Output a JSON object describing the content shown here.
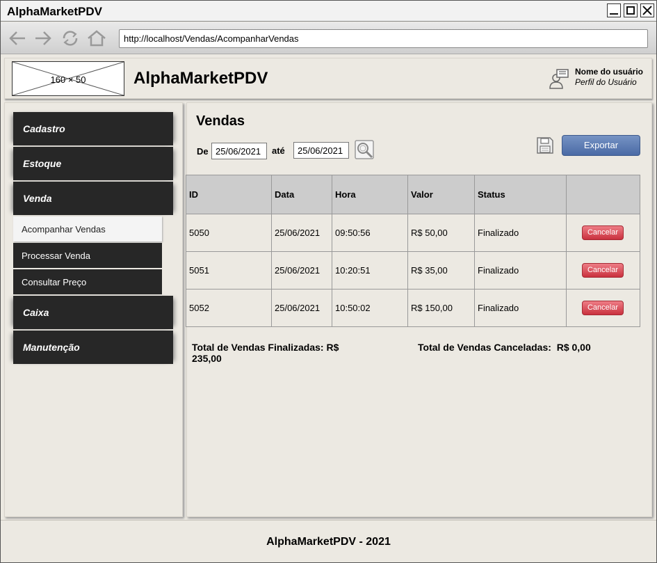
{
  "window": {
    "title": "AlphaMarketPDV"
  },
  "browser": {
    "url": "http://localhost/Vendas/AcompanharVendas"
  },
  "header": {
    "logo_placeholder": "160 × 50",
    "app_title": "AlphaMarketPDV",
    "user_name": "Nome do usuário",
    "user_role": "Perfil do Usuário"
  },
  "sidebar": {
    "items": [
      {
        "label": "Cadastro"
      },
      {
        "label": "Estoque"
      },
      {
        "label": "Venda"
      },
      {
        "label": "Acompanhar Vendas",
        "active": true
      },
      {
        "label": "Processar Venda"
      },
      {
        "label": "Consultar Preço"
      },
      {
        "label": "Caixa"
      },
      {
        "label": "Manutenção"
      }
    ]
  },
  "main": {
    "title": "Vendas",
    "filter": {
      "from_label": "De",
      "from_value": "25/06/2021",
      "to_label": "até",
      "to_value": "25/06/2021"
    },
    "export_label": "Exportar",
    "table": {
      "columns": [
        "ID",
        "Data",
        "Hora",
        "Valor",
        "Status",
        ""
      ],
      "rows": [
        {
          "id": "5050",
          "date": "25/06/2021",
          "time": "09:50:56",
          "value": "R$ 50,00",
          "status": "Finalizado",
          "action": "Cancelar"
        },
        {
          "id": "5051",
          "date": "25/06/2021",
          "time": "10:20:51",
          "value": "R$ 35,00",
          "status": "Finalizado",
          "action": "Cancelar"
        },
        {
          "id": "5052",
          "date": "25/06/2021",
          "time": "10:50:02",
          "value": "R$ 150,00",
          "status": "Finalizado",
          "action": "Cancelar"
        }
      ]
    },
    "totals": {
      "finalized_label": "Total de Vendas Finalizadas: R$",
      "finalized_value": "235,00",
      "canceled_label": "Total de Vendas Canceladas:",
      "canceled_value": "R$ 0,00"
    }
  },
  "footer": {
    "text": "AlphaMarketPDV - 2021"
  },
  "colors": {
    "menu_dark": "#272727",
    "export_blue": "#4a6aa5",
    "cancel_red": "#c9313e",
    "background": "#ece9e2"
  }
}
